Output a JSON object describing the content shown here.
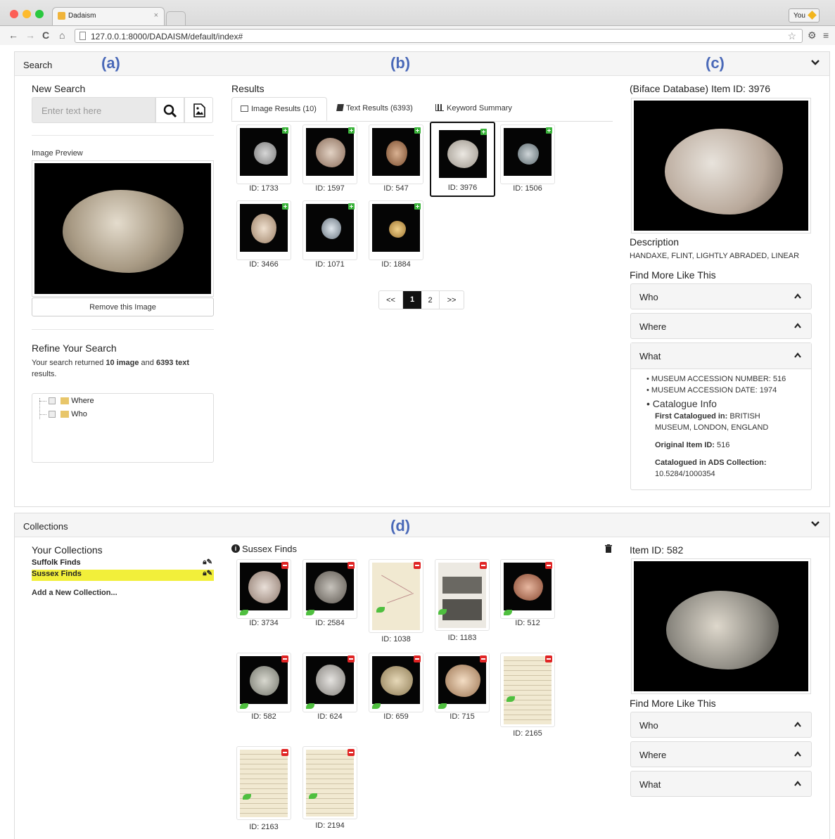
{
  "browser": {
    "tab_title": "Dadaism",
    "url": "127.0.0.1:8000/DADAISM/default/index#",
    "user_label": "You"
  },
  "labels": {
    "a": "(a)",
    "b": "(b)",
    "c": "(c)",
    "d": "(d)"
  },
  "search_panel": {
    "title": "Search",
    "new_search": "New Search",
    "search_placeholder": "Enter text here",
    "image_preview": "Image Preview",
    "remove_image": "Remove this Image",
    "refine_title": "Refine Your Search",
    "refine_text_1": "Your search returned ",
    "refine_bold_1": "10 image",
    "refine_text_2": " and ",
    "refine_bold_2": "6393 text",
    "refine_text_3": "results.",
    "tree": [
      "Where",
      "Who"
    ]
  },
  "results": {
    "title": "Results",
    "tabs": [
      "Image Results (10)",
      "Text Results (6393)",
      "Keyword Summary"
    ],
    "items": [
      "ID: 1733",
      "ID: 1597",
      "ID: 547",
      "ID: 3976",
      "ID: 1506",
      "ID: 3466",
      "ID: 1071",
      "ID: 1884"
    ],
    "pagination": [
      "<<",
      "1",
      "2",
      ">>"
    ]
  },
  "detail": {
    "title": "(Biface Database) Item ID: 3976",
    "description_title": "Description",
    "description": "HANDAXE, FLINT, LIGHTLY ABRADED, LINEAR",
    "find_more": "Find More Like This",
    "sections": [
      "Who",
      "Where",
      "What"
    ],
    "what_items": [
      "MUSEUM ACCESSION NUMBER: 516",
      "MUSEUM ACCESSION DATE: 1974"
    ],
    "catalogue_title": "Catalogue Info",
    "first_catalogued_label": "First Catalogued in:",
    "first_catalogued_value": " BRITISH",
    "first_catalogued_value_2": "MUSEUM, LONDON, ENGLAND",
    "original_id_label": "Original Item ID:",
    "original_id_value": " 516",
    "ads_label": "Catalogued in ADS Collection:",
    "ads_value": "10.5284/1000354"
  },
  "collections_panel": {
    "title": "Collections",
    "your_collections": "Your Collections",
    "collections": [
      "Suffolk Finds",
      "Sussex Finds"
    ],
    "add_new": "Add a New Collection...",
    "current": "Sussex Finds",
    "items": [
      "ID: 3734",
      "ID: 2584",
      "ID: 1038",
      "ID: 1183",
      "ID: 512",
      "ID: 582",
      "ID: 624",
      "ID: 659",
      "ID: 715",
      "ID: 2165",
      "ID: 2163",
      "ID: 2194"
    ]
  },
  "collection_detail": {
    "title": "Item ID: 582",
    "find_more": "Find More Like This",
    "sections": [
      "Who",
      "Where",
      "What"
    ]
  },
  "colors": {
    "accent_label": "#4a69b8",
    "highlight": "#f2ef3a",
    "plus_green": "#3bb33b",
    "minus_red": "#e02424"
  }
}
